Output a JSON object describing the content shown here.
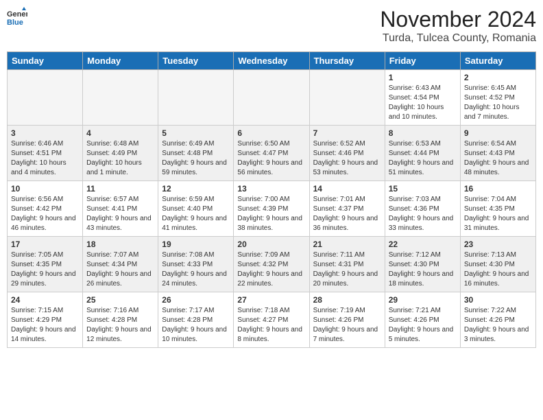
{
  "logo": {
    "general": "General",
    "blue": "Blue"
  },
  "header": {
    "month": "November 2024",
    "location": "Turda, Tulcea County, Romania"
  },
  "days_of_week": [
    "Sunday",
    "Monday",
    "Tuesday",
    "Wednesday",
    "Thursday",
    "Friday",
    "Saturday"
  ],
  "weeks": [
    [
      {
        "day": "",
        "info": ""
      },
      {
        "day": "",
        "info": ""
      },
      {
        "day": "",
        "info": ""
      },
      {
        "day": "",
        "info": ""
      },
      {
        "day": "",
        "info": ""
      },
      {
        "day": "1",
        "info": "Sunrise: 6:43 AM\nSunset: 4:54 PM\nDaylight: 10 hours and 10 minutes."
      },
      {
        "day": "2",
        "info": "Sunrise: 6:45 AM\nSunset: 4:52 PM\nDaylight: 10 hours and 7 minutes."
      }
    ],
    [
      {
        "day": "3",
        "info": "Sunrise: 6:46 AM\nSunset: 4:51 PM\nDaylight: 10 hours and 4 minutes."
      },
      {
        "day": "4",
        "info": "Sunrise: 6:48 AM\nSunset: 4:49 PM\nDaylight: 10 hours and 1 minute."
      },
      {
        "day": "5",
        "info": "Sunrise: 6:49 AM\nSunset: 4:48 PM\nDaylight: 9 hours and 59 minutes."
      },
      {
        "day": "6",
        "info": "Sunrise: 6:50 AM\nSunset: 4:47 PM\nDaylight: 9 hours and 56 minutes."
      },
      {
        "day": "7",
        "info": "Sunrise: 6:52 AM\nSunset: 4:46 PM\nDaylight: 9 hours and 53 minutes."
      },
      {
        "day": "8",
        "info": "Sunrise: 6:53 AM\nSunset: 4:44 PM\nDaylight: 9 hours and 51 minutes."
      },
      {
        "day": "9",
        "info": "Sunrise: 6:54 AM\nSunset: 4:43 PM\nDaylight: 9 hours and 48 minutes."
      }
    ],
    [
      {
        "day": "10",
        "info": "Sunrise: 6:56 AM\nSunset: 4:42 PM\nDaylight: 9 hours and 46 minutes."
      },
      {
        "day": "11",
        "info": "Sunrise: 6:57 AM\nSunset: 4:41 PM\nDaylight: 9 hours and 43 minutes."
      },
      {
        "day": "12",
        "info": "Sunrise: 6:59 AM\nSunset: 4:40 PM\nDaylight: 9 hours and 41 minutes."
      },
      {
        "day": "13",
        "info": "Sunrise: 7:00 AM\nSunset: 4:39 PM\nDaylight: 9 hours and 38 minutes."
      },
      {
        "day": "14",
        "info": "Sunrise: 7:01 AM\nSunset: 4:37 PM\nDaylight: 9 hours and 36 minutes."
      },
      {
        "day": "15",
        "info": "Sunrise: 7:03 AM\nSunset: 4:36 PM\nDaylight: 9 hours and 33 minutes."
      },
      {
        "day": "16",
        "info": "Sunrise: 7:04 AM\nSunset: 4:35 PM\nDaylight: 9 hours and 31 minutes."
      }
    ],
    [
      {
        "day": "17",
        "info": "Sunrise: 7:05 AM\nSunset: 4:35 PM\nDaylight: 9 hours and 29 minutes."
      },
      {
        "day": "18",
        "info": "Sunrise: 7:07 AM\nSunset: 4:34 PM\nDaylight: 9 hours and 26 minutes."
      },
      {
        "day": "19",
        "info": "Sunrise: 7:08 AM\nSunset: 4:33 PM\nDaylight: 9 hours and 24 minutes."
      },
      {
        "day": "20",
        "info": "Sunrise: 7:09 AM\nSunset: 4:32 PM\nDaylight: 9 hours and 22 minutes."
      },
      {
        "day": "21",
        "info": "Sunrise: 7:11 AM\nSunset: 4:31 PM\nDaylight: 9 hours and 20 minutes."
      },
      {
        "day": "22",
        "info": "Sunrise: 7:12 AM\nSunset: 4:30 PM\nDaylight: 9 hours and 18 minutes."
      },
      {
        "day": "23",
        "info": "Sunrise: 7:13 AM\nSunset: 4:30 PM\nDaylight: 9 hours and 16 minutes."
      }
    ],
    [
      {
        "day": "24",
        "info": "Sunrise: 7:15 AM\nSunset: 4:29 PM\nDaylight: 9 hours and 14 minutes."
      },
      {
        "day": "25",
        "info": "Sunrise: 7:16 AM\nSunset: 4:28 PM\nDaylight: 9 hours and 12 minutes."
      },
      {
        "day": "26",
        "info": "Sunrise: 7:17 AM\nSunset: 4:28 PM\nDaylight: 9 hours and 10 minutes."
      },
      {
        "day": "27",
        "info": "Sunrise: 7:18 AM\nSunset: 4:27 PM\nDaylight: 9 hours and 8 minutes."
      },
      {
        "day": "28",
        "info": "Sunrise: 7:19 AM\nSunset: 4:26 PM\nDaylight: 9 hours and 7 minutes."
      },
      {
        "day": "29",
        "info": "Sunrise: 7:21 AM\nSunset: 4:26 PM\nDaylight: 9 hours and 5 minutes."
      },
      {
        "day": "30",
        "info": "Sunrise: 7:22 AM\nSunset: 4:26 PM\nDaylight: 9 hours and 3 minutes."
      }
    ]
  ]
}
